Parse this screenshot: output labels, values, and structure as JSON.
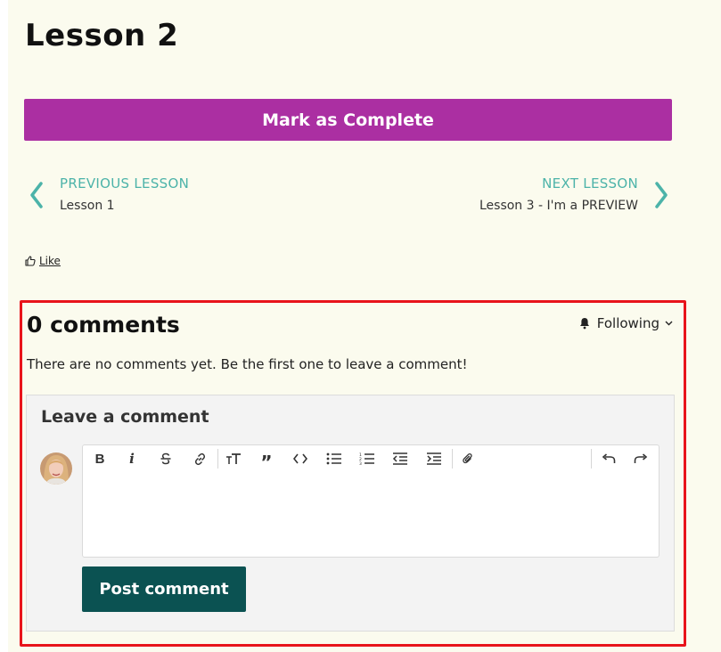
{
  "lesson": {
    "title": "Lesson 2"
  },
  "actions": {
    "mark_complete": "Mark as Complete"
  },
  "navigation": {
    "previous": {
      "kicker": "PREVIOUS LESSON",
      "label": "Lesson 1"
    },
    "next": {
      "kicker": "NEXT LESSON",
      "label": "Lesson 3 - I'm a PREVIEW"
    }
  },
  "like": {
    "label": "Like"
  },
  "comments": {
    "count_label": "0 comments",
    "following_label": "Following",
    "empty_message": "There are no comments yet. Be the first one to leave a comment!",
    "form": {
      "title": "Leave a comment",
      "submit_label": "Post comment",
      "toolbar_icons": [
        "bold-icon",
        "italic-icon",
        "strikethrough-icon",
        "link-icon",
        "text-size-icon",
        "quote-icon",
        "code-icon",
        "bullet-list-icon",
        "numbered-list-icon",
        "outdent-icon",
        "indent-icon",
        "attachment-icon",
        "undo-icon",
        "redo-icon"
      ]
    }
  },
  "colors": {
    "page_background": "#fbfbee",
    "accent_purple": "#ab2fa2",
    "teal": "#4cb3a9",
    "post_button": "#0b5252",
    "highlight_border": "#e8141b"
  }
}
